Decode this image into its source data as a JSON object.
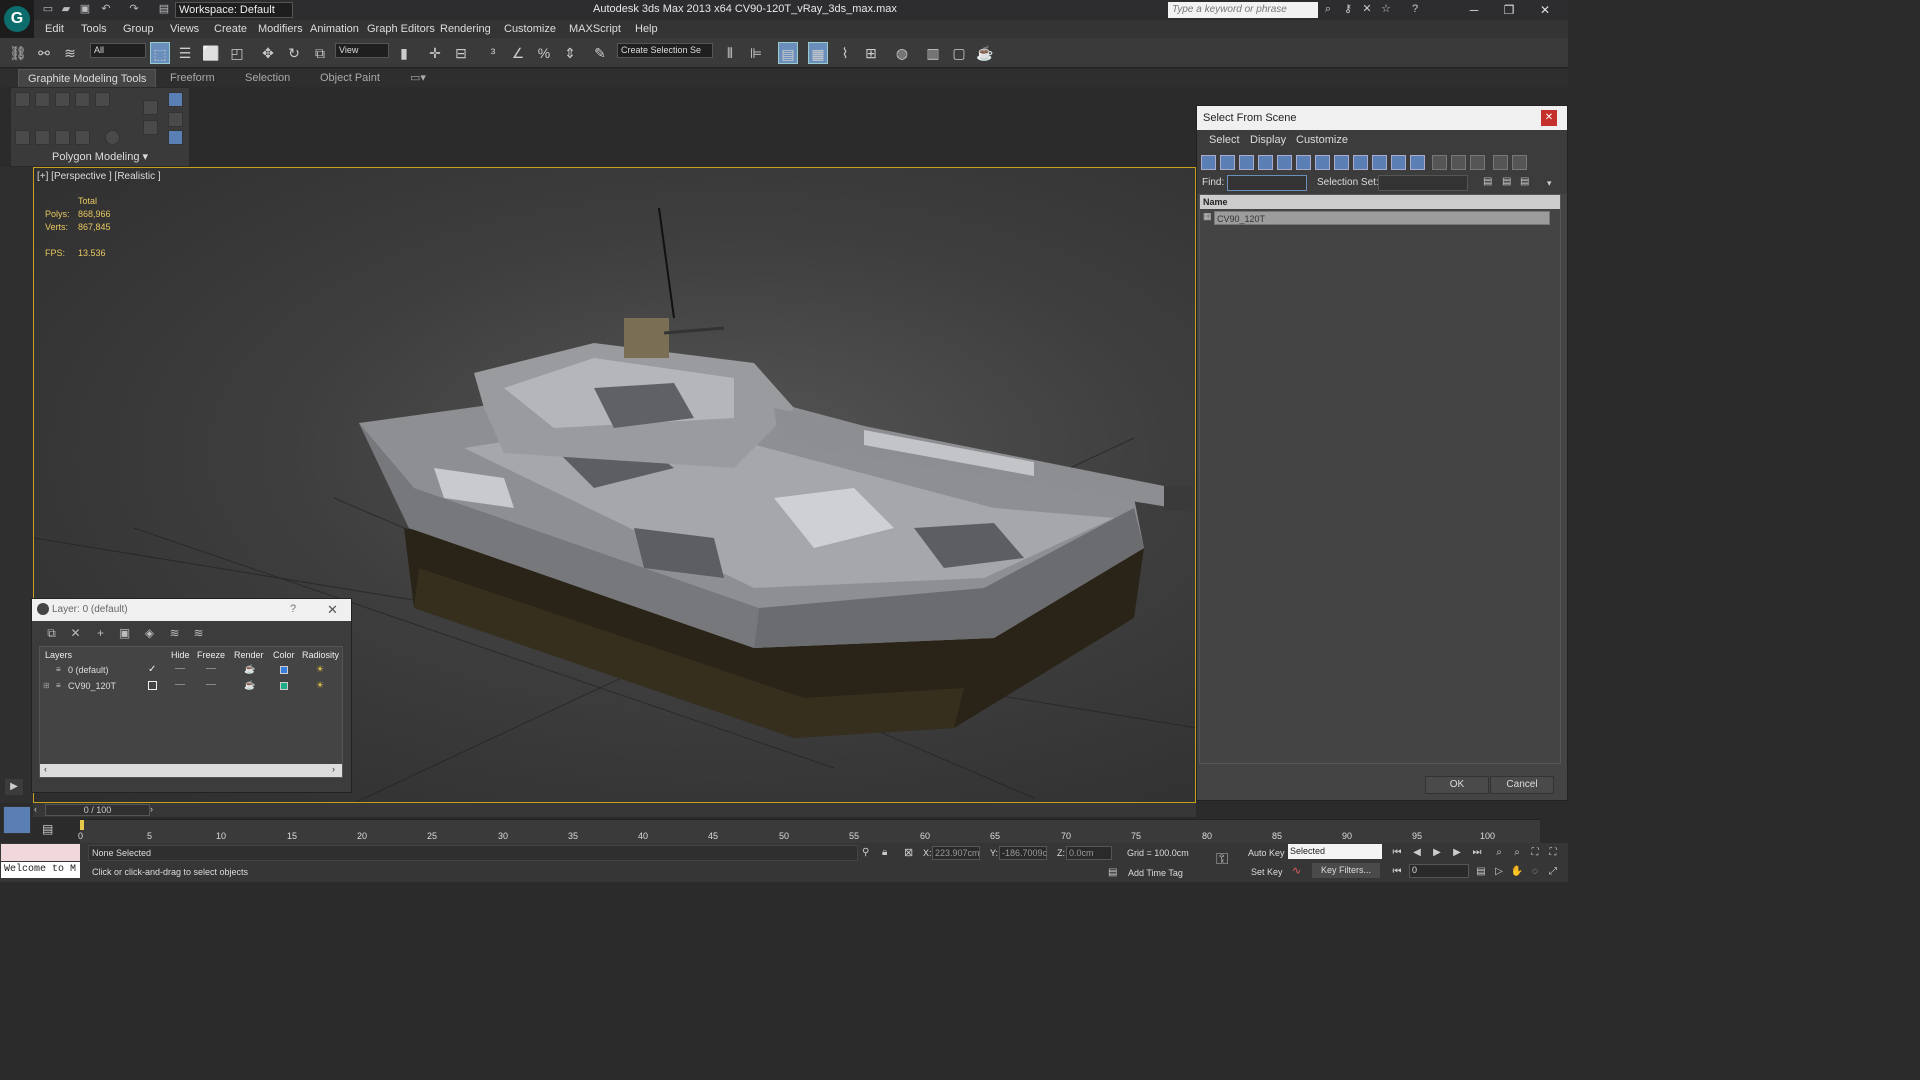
{
  "app": {
    "workspace_label": "Workspace: Default",
    "title": "Autodesk 3ds Max  2013 x64      CV90-120T_vRay_3ds_max.max",
    "search_placeholder": "Type a keyword or phrase"
  },
  "menu": [
    "Edit",
    "Tools",
    "Group",
    "Views",
    "Create",
    "Modifiers",
    "Animation",
    "Graph Editors",
    "Rendering",
    "Customize",
    "MAXScript",
    "Help"
  ],
  "toolbar": {
    "selection_filter": "All",
    "ref_coord": "View",
    "named_selection": "Create Selection Se"
  },
  "ribbon": {
    "tabs": [
      "Graphite Modeling Tools",
      "Freeform",
      "Selection",
      "Object Paint"
    ],
    "panel_label": "Polygon Modeling ▾"
  },
  "viewport": {
    "label": "[+] [Perspective ] [Realistic ]",
    "stats": {
      "total_label": "Total",
      "polys_label": "Polys:",
      "polys_value": "868,966",
      "verts_label": "Verts:",
      "verts_value": "867,845",
      "fps_label": "FPS:",
      "fps_value": "13.536"
    }
  },
  "select_from_scene": {
    "title": "Select From Scene",
    "menu": [
      "Select",
      "Display",
      "Customize"
    ],
    "find_label": "Find:",
    "selset_label": "Selection Set:",
    "column_name": "Name",
    "items": [
      "CV90_120T"
    ],
    "ok": "OK",
    "cancel": "Cancel"
  },
  "layer_window": {
    "title": "Layer: 0 (default)",
    "help": "?",
    "columns": [
      "Layers",
      "Hide",
      "Freeze",
      "Render",
      "Color",
      "Radiosity"
    ],
    "rows": [
      {
        "name": "0 (default)",
        "color": "#3a7de0"
      },
      {
        "name": "CV90_120T",
        "color": "#1fae8a"
      }
    ]
  },
  "timeline": {
    "slider": "0 / 100",
    "ticks": [
      "0",
      "5",
      "10",
      "15",
      "20",
      "25",
      "30",
      "35",
      "40",
      "45",
      "50",
      "55",
      "60",
      "65",
      "70",
      "75",
      "80",
      "85",
      "90",
      "95",
      "100"
    ]
  },
  "status": {
    "welcome": "Welcome to M",
    "selection": "None Selected",
    "prompt": "Click or click-and-drag to select objects",
    "x_label": "X:",
    "x_value": "223.907cm",
    "y_label": "Y:",
    "y_value": "-186.7009c",
    "z_label": "Z:",
    "z_value": "0.0cm",
    "grid": "Grid = 100.0cm",
    "add_time_tag": "Add Time Tag",
    "auto_key": "Auto Key",
    "set_key": "Set Key",
    "selected": "Selected",
    "key_filters": "Key Filters...",
    "frame": "0"
  }
}
